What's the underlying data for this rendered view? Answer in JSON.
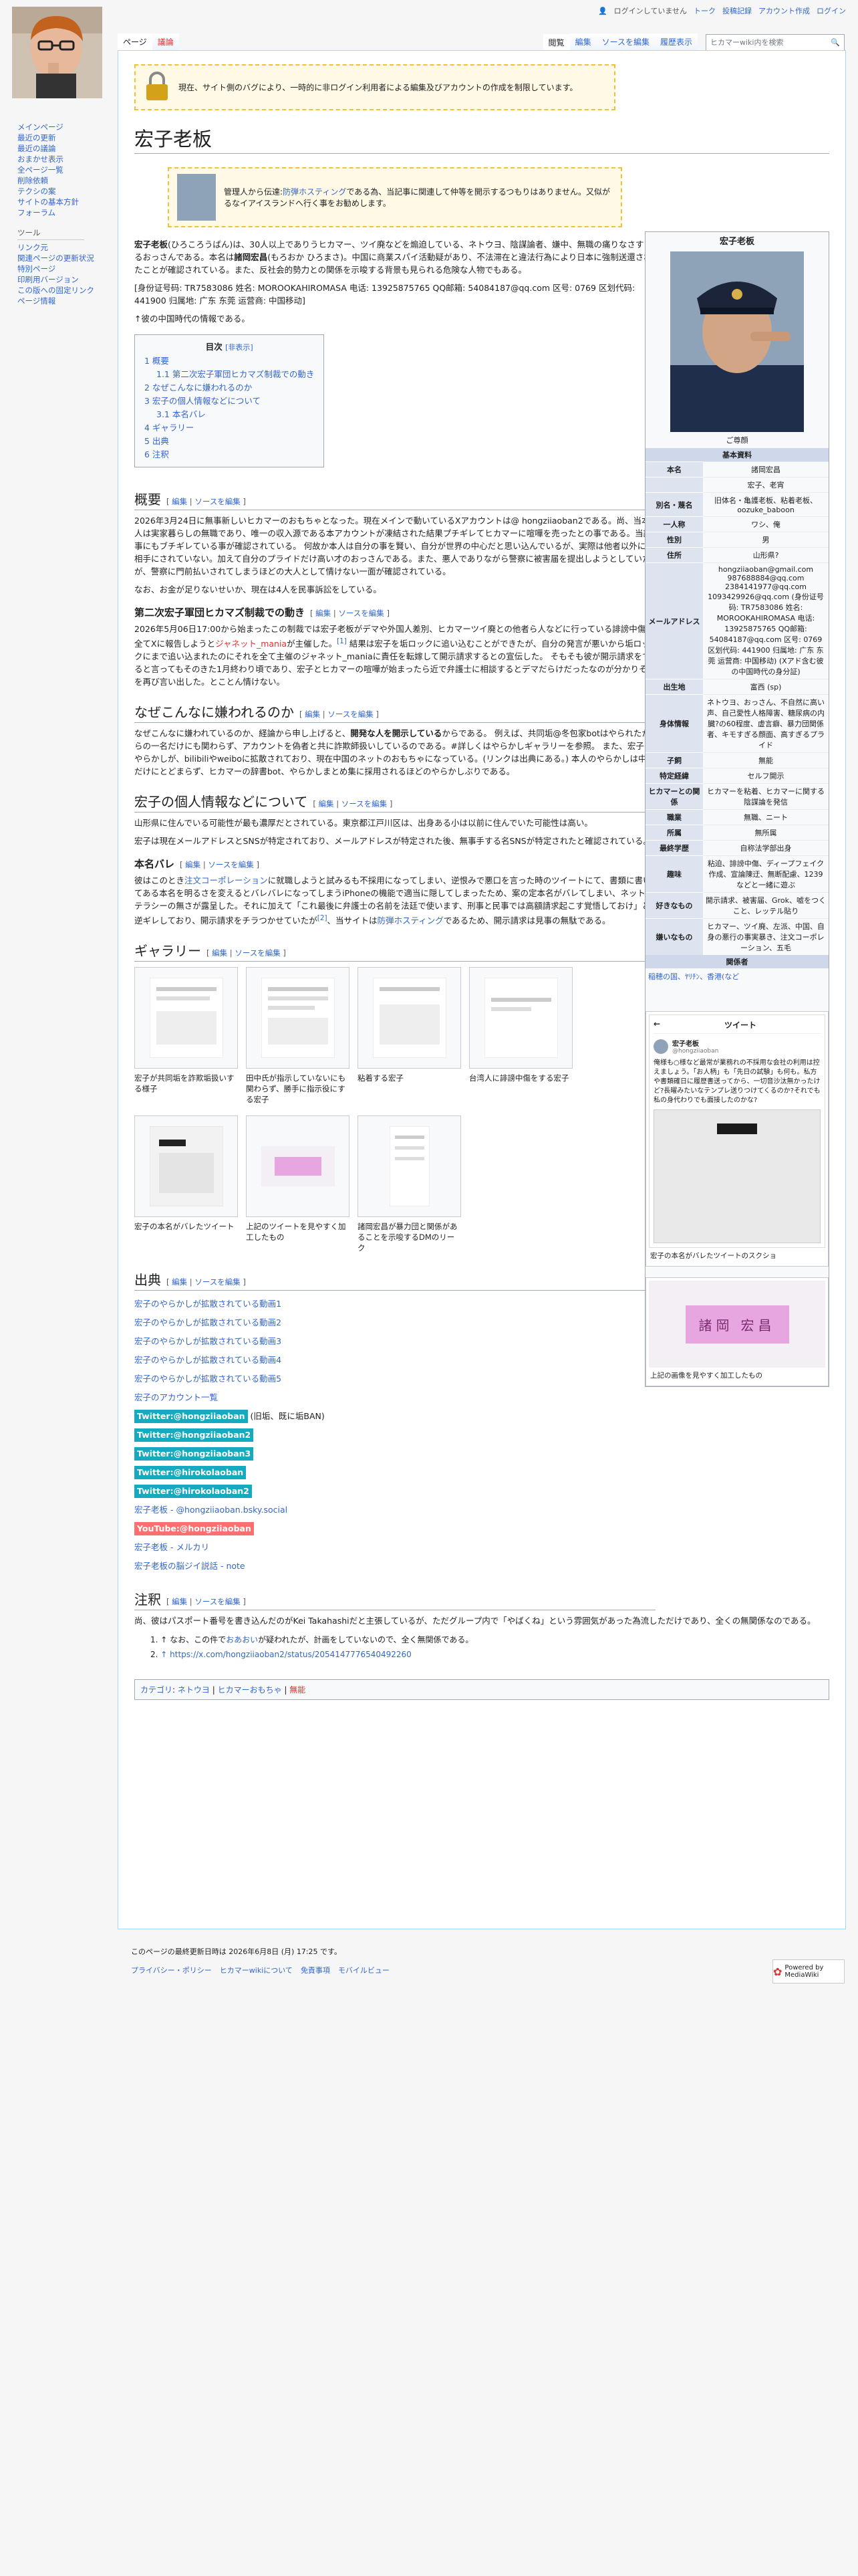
{
  "personal_tools": {
    "not_logged_in": "ログインしていません",
    "talk": "トーク",
    "contributions": "投稿記録",
    "create_account": "アカウント作成",
    "login": "ログイン"
  },
  "tabs": {
    "page": "ページ",
    "discussion": "議論",
    "read": "閲覧",
    "edit": "編集",
    "edit_source": "ソースを編集",
    "history": "履歴表示"
  },
  "search": {
    "placeholder": "ヒカマーwiki内を検索"
  },
  "sidebar": {
    "nav": [
      "メインページ",
      "最近の更新",
      "最近の議論",
      "おまかせ表示",
      "全ページ一覧",
      "削除依頼",
      "テクシの案",
      "サイトの基本方針",
      "フォーラム"
    ],
    "tools_heading": "ツール",
    "tools": [
      "リンク元",
      "関連ページの更新状況",
      "特別ページ",
      "印刷用バージョン",
      "この版への固定リンク",
      "ページ情報"
    ]
  },
  "sitenotice": "現在、サイト側のバグにより、一時的に非ログイン利用者による編集及びアカウントの作成を制限しています。",
  "page_title": "宏子老板",
  "admin_notice": {
    "pre": "管理人から伝達:",
    "link": "防弾ホスティング",
    "post": "である為、当記事に関連して仲等を開示するつもりはありません。又似がるなイアイスランドへ行く事をお勧めします。"
  },
  "intro": {
    "p1_bold": "宏子老板",
    "p1_a": "(ひろころうばん)は、30人以上でありうヒカマー、ツイ廃などを煽迫している、ネトウヨ、陰謀論者、嫌中、無職の痛りなさすぎるおっさんである。本名は",
    "p1_bold2": "諸岡宏昌",
    "p1_b": "(もろおか ひろまさ)。中国に商業スパイ活動疑があり、不法滞在と違法行為により日本に強制送還されたことが確認されている。また、反社会的勢力との関係を示唆する背景も見られる危険な人物でもある。",
    "p2": "[身份证号码: TR7583086 姓名: MOROOKAHIROMASA 电话: 13925875765 QQ邮箱: 54084187@qq.com 区号: 0769 区划代码: 441900 归属地: 广东 东莞 运营商: 中国移动]",
    "p3": "↑彼の中国時代の情報である。"
  },
  "toc": {
    "title": "目次",
    "toggle": "[非表示]",
    "items": [
      "1  概要",
      "1.1  第二次宏子軍団ヒカマズ制裁での動き",
      "2  なぜこんなに嫌われるのか",
      "3  宏子の個人情報などについて",
      "3.1  本名バレ",
      "4  ギャラリー",
      "5  出典",
      "6  注釈"
    ]
  },
  "edit_links": {
    "edit": "編集",
    "edit_source": "ソースを編集"
  },
  "sections": {
    "overview": {
      "title": "概要",
      "p1": "2026年3月24日に無事新しいヒカマーのおもちゃとなった。現在メインで動いているXアカウントは@ hongziiaoban2である。尚、当本人は実家暮らしの無職であり、唯一の収入源である本アカウントが凍結された結果プチギレてヒカマーに喧嘩を売ったとの事である。当記事にもブチギレている事が確認されている。 何故か本人は自分の事を賢い、自分が世界の中心だと思い込んでいるが、実際は他者以外には相手にされていない。加えて自分のプライドだけ高い才のおっさんである。また、悪人でありながら警察に被害届を提出しようとしていたが、警察に門前払いされてしまうほどの大人として情けない一面が確認されている。",
      "p2": "なお、お金が足りないせいか、現在は4人を民事訴訟をしている。"
    },
    "second": {
      "title": "第二次宏子軍団ヒカマズ制裁での動き",
      "p1a": "2026年5月06日17:00から始まったこの制裁では宏子老板がデマや外国人差別、ヒカマーツイ廃との他者ら人などに行っている誹謗中傷を全てXに報告しようと",
      "p1_link": "ジャネット_mania",
      "p1b": "が主催した。",
      "p1_ref": "[1]",
      "p1c": " 結果は宏子を垢ロックに追い込むことができたが、自分の発言が悪いから垢ロックにまで追い込まれたのにそれを全て主催のジャネット_maniaに責任を転嫁して開示請求するとの宣伝した。 そもそも彼が開示請求をすると言ってもそのきた1月終わり頃であり、宏子とヒカマーの喧嘩が始まったら近で弁護士に相談するとデマだらけだったなのが分かりそれを再び言い出した。とことん情けない。"
    },
    "why": {
      "title": "なぜこんなに嫌われるのか",
      "p1a": "なぜこんなに嫌われているのか、経論から申し上げると、",
      "p1_bold": "開発な人を開示している",
      "p1b": "からである。 例えば、共同垢@冬包家botはやられたからの一名だけにも関わらず、アカウントを偽者と共に詐欺師扱いしているのである。#詳しくはやらかしギャラリーを参照。 また、宏子のやらかしが、bilibiliやweiboに拡散されており、現在中国のネットのおもちゃになっている。(リンクは出典にある。) 本人のやらかしは中国だけにとどまらず、ヒカマーの辞書bot、やらかしまとめ集に採用されるほどのやらかしぶりである。"
    },
    "personal": {
      "title": "宏子の個人情報などについて",
      "p1": "山形県に住んでいる可能性が最も濃厚だとされている。東京都江戸川区は、出身ある小は以前に住んでいた可能性は高い。",
      "p2": "宏子は現在メールアドレスとSNSが特定されており、メールアドレスが特定された後、無事手する名SNSが特定されたと確認されている。"
    },
    "realname": {
      "title": "本名バレ",
      "p1a": "彼はこのとき",
      "p1_link": "注文コーポレーション",
      "p1b": "に就職しようと試みるも不採用になってしまい、逆恨みで悪口を言った時のツイートにて、書類に書いてある本名を明るさを変えるとバレバレになってしまうiPhoneの機能で適当に隠してしまったため、案の定本名がバレてしまい、ネットリテラシーの無さが露呈した。それに加えて「これ最後に弁護士の名前を法廷で使います、刑事と民事では高額請求起こす覚悟しておけ」と逆ギレしており、開示請求をチラつかせていたが",
      "p1_ref": "[2]",
      "p1c": "、当サイトは",
      "p1_link2": "防弾ホスティング",
      "p1d": "であるため、開示請求は見事の無駄である。"
    },
    "gallery": {
      "title": "ギャラリー",
      "items": [
        "宏子が共同垢を詐欺垢扱いする様子",
        "田中氏が指示していないにも関わらず、勝手に指示役にする宏子",
        "粘着する宏子",
        "台湾人に誹謗中傷をする宏子",
        "宏子の本名がバレたツイート",
        "上記のツイートを見やすく加工したもの",
        "諸岡宏昌が暴力団と関係があることを示唆するDMのリーク"
      ]
    },
    "sources": {
      "title": "出典",
      "links": [
        "宏子のやらかしが拡散されている動画1",
        "宏子のやらかしが拡散されている動画2",
        "宏子のやらかしが拡散されている動画3",
        "宏子のやらかしが拡散されている動画4",
        "宏子のやらかしが拡散されている動画5",
        "宏子のアカウント一覧"
      ],
      "tw1": "Twitter:@hongziiaoban",
      "tw1_note": "(旧垢、既に垢BAN)",
      "tw2": "Twitter:@hongziiaoban2",
      "tw3": "Twitter:@hongziiaoban3",
      "tw4": "Twitter:@hirokolaoban",
      "tw5": "Twitter:@hirokolaoban2",
      "bsky": "宏子老板 - @hongziiaoban.bsky.social",
      "yt": "YouTube:@hongziiaoban",
      "m1": "宏子老板 - メルカリ",
      "m2": "宏子老板の脳ジイ説話 - note"
    },
    "notes": {
      "title": "注釈",
      "intro": "尚、彼はパスポート番号を書き込んだのがKei Takahashiだと主張しているが、ただグループ内で「やばくね」という雰囲気があった為流しただけであり、全くの無関係なのである。",
      "n1a": "↑ なお、この件で",
      "n1_link": "おあおい",
      "n1b": "が疑われたが、計画をしていないので、全く無関係である。",
      "n2": "↑ https://x.com/hongziiaoban2/status/2054147776540492260"
    },
    "categories": {
      "label": "カテゴリ",
      "items": [
        "ネトウヨ",
        "ヒカマーおもちゃ"
      ],
      "red": "無能"
    }
  },
  "infobox": {
    "title": "宏子老板",
    "caption": "ご尊顔",
    "section1": "基本資料",
    "rows": [
      {
        "k": "本名",
        "v": "諸岡宏昌"
      },
      {
        "k": "",
        "v": "宏子、老宵"
      },
      {
        "k": "別名・蔑名",
        "v": "旧体名・亀護老板、粘着老板、oozuke_baboon"
      },
      {
        "k": "一人称",
        "v": "ワシ、俺"
      },
      {
        "k": "性別",
        "v": "男"
      },
      {
        "k": "住所",
        "v": "山形県?"
      },
      {
        "k": "メールアドレス",
        "v": "hongziiaoban@gmail.com 987688884@qq.com 2384141977@qq.com 1093429926@qq.com (身份证号码: TR7583086 姓名: MOROOKAHIROMASA 电话: 13925875765 QQ邮箱: 54084187@qq.com 区号: 0769 区划代码: 441900 归属地: 广东 东莞 运营商: 中国移动) (Xアド含む彼の中国時代の身分証)"
      },
      {
        "k": "出生地",
        "v": "富西 (sp)"
      },
      {
        "k": "身体情報",
        "v": "ネトウヨ、おっさん、不自然に高い声、自己愛性人格障害、糖尿病の内臓?の60程度、虚言癖、暴力団関係者、キモすぎる顔面、高すぎるプライド"
      },
      {
        "k": "子飼",
        "v": "無能"
      },
      {
        "k": "特定経緯",
        "v": "セルフ開示"
      },
      {
        "k": "ヒカマーとの関係",
        "v": "ヒカマーを粘着、ヒカマーに関する陰謀論を発信"
      },
      {
        "k": "職業",
        "v": "無職、ニート"
      },
      {
        "k": "所属",
        "v": "無所属"
      },
      {
        "k": "最終学歴",
        "v": "自称法学部出身"
      },
      {
        "k": "趣味",
        "v": "粘迫、誹謗中傷、ディープフェイク作成、宣論陳迂、無断配慮、1239などと一緒に遊ぶ"
      },
      {
        "k": "好きなもの",
        "v": "開示請求、被害届、Grok、嘘をつくこと、レッテル貼り"
      },
      {
        "k": "嫌いなもの",
        "v": "ヒカマー、ツイ廃、左派、中国、自身の悪行の事実暴き、注文コーポレーション、五毛"
      }
    ],
    "section2": "関係者",
    "related": "稲穂の国、ﾔﾘﾁﾝ、香港(など"
  },
  "tweet": {
    "header": "ツイート",
    "name": "宏子老板",
    "handle": "@hongziiaoban",
    "text": "俺様も○様など最常が業務れの不採用な会社の利用は控えましょう。「お人柄」も「先日の試験」も何も。私方や書類確日に履歴書送ってから、一切音沙汰無かったけど?長曜みたいなテンプレ送りつけてくるのか?それでも私の身代わりでも面接したのかな?",
    "caption": "宏子の本名がバレたツイートのスクショ",
    "caption2": "上記の画像を見やすく加工したもの",
    "stamp_text": "諸岡 宏昌"
  },
  "footer": {
    "last_edit": "このページの最終更新日時は 2026年6月8日 (月) 17:25 です。",
    "links": [
      "プライバシー・ポリシー",
      "ヒカマーwikiについて",
      "免責事項",
      "モバイルビュー"
    ],
    "powered": "Powered by MediaWiki"
  }
}
